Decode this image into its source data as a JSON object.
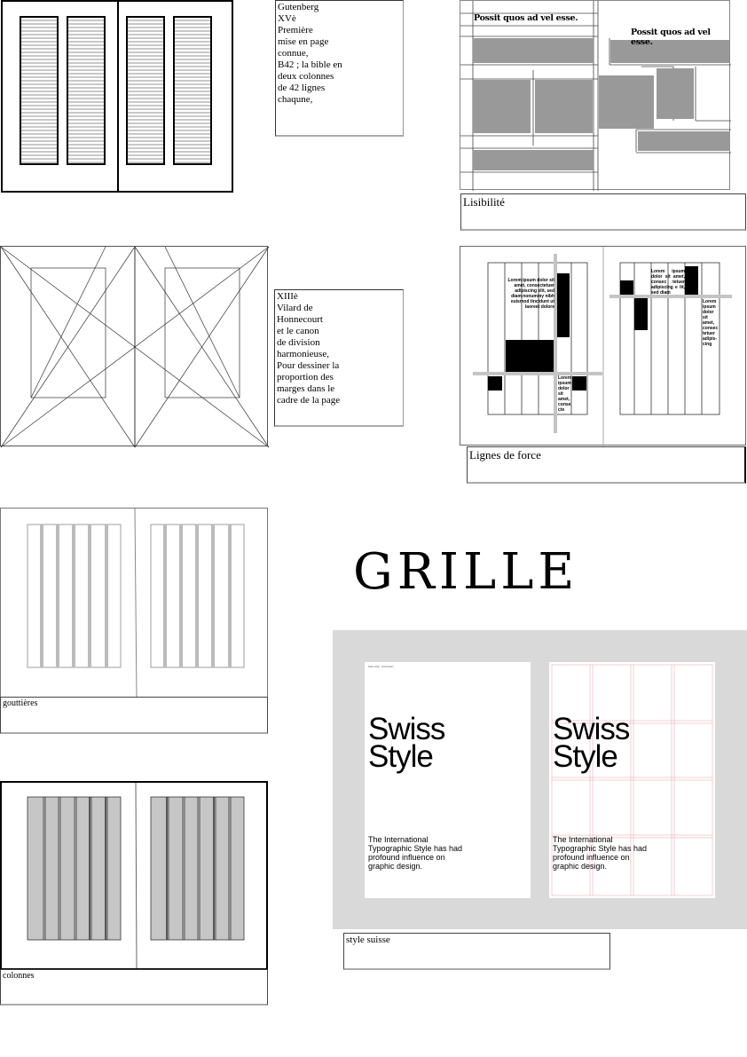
{
  "title": "GRILLE",
  "gutenberg": {
    "text": "Gutenberg\nXVè\nPremière\nmise en page\nconnue,\nB42 ; la bible en\ndeux colonnes\nde 42 lignes\nchaqune,"
  },
  "lisibilite": {
    "label": "Lisibilité",
    "heading_left": "Possit quos ad vel esse.",
    "heading_right": "Possit quos ad vel esse."
  },
  "villard": {
    "text": "XIIIè\nVilard de\nHonnecourt\net  le canon\nde division\nharmonieuse,\nPour dessiner la\nproportion des\nmarges dans le\ncadre de la page"
  },
  "lignes_de_force": {
    "label": "Lignes de force",
    "text_a": "Lorem ipsum dolor sit amet, consectetuer adipiscing elit, sed diam nonummy nibh euismod tincidunt ut laoreet dolore",
    "text_b": "Lorem ipsum dolor sit amet, conse cte",
    "text_c": "Lorem ipsum dolor sit amet, consec tetuer adipiscing e lit, sed diam",
    "text_d": "Lorem ipsum dolor sit amet, consec tetuer adipis-cing"
  },
  "gouttieres": {
    "label": "gouttières"
  },
  "colonnes": {
    "label": "colonnes"
  },
  "swiss": {
    "label": "style suisse",
    "poster_title": "Swiss\nStyle",
    "poster_subtitle": "The International Typographic Style has had profound influence on graphic design.",
    "accent": "#e8a0a8",
    "panel_bg": "#d9d9d9"
  }
}
